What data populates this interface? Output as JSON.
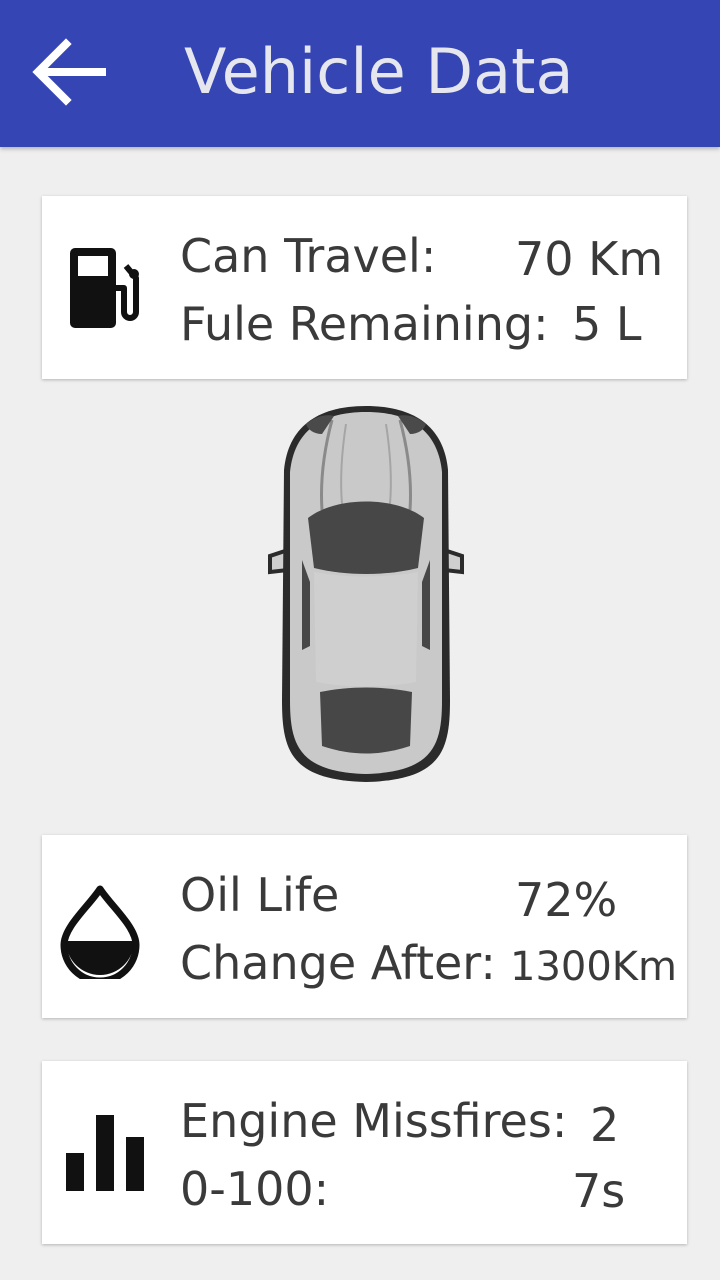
{
  "app_bar": {
    "title": "Vehicle Data",
    "background": "#3545b4",
    "back_icon": "arrow-left-icon"
  },
  "fuel_card": {
    "icon": "fuel-pump-icon",
    "can_travel_label": "Can Travel:",
    "can_travel_value": "70 Km",
    "fuel_remaining_label": "Fule Remaining:",
    "fuel_remaining_value": "5 L"
  },
  "car_image": {
    "icon": "car-top-view-icon"
  },
  "oil_card": {
    "icon": "oil-drop-icon",
    "oil_life_label": "Oil Life",
    "oil_life_value": "72%",
    "change_after_label": "Change After:",
    "change_after_value": "1300Km"
  },
  "engine_card": {
    "icon": "bar-chart-icon",
    "missfires_label": "Engine Missfires:",
    "missfires_value": "2",
    "acceleration_label": "0-100:",
    "acceleration_value": "7s"
  }
}
